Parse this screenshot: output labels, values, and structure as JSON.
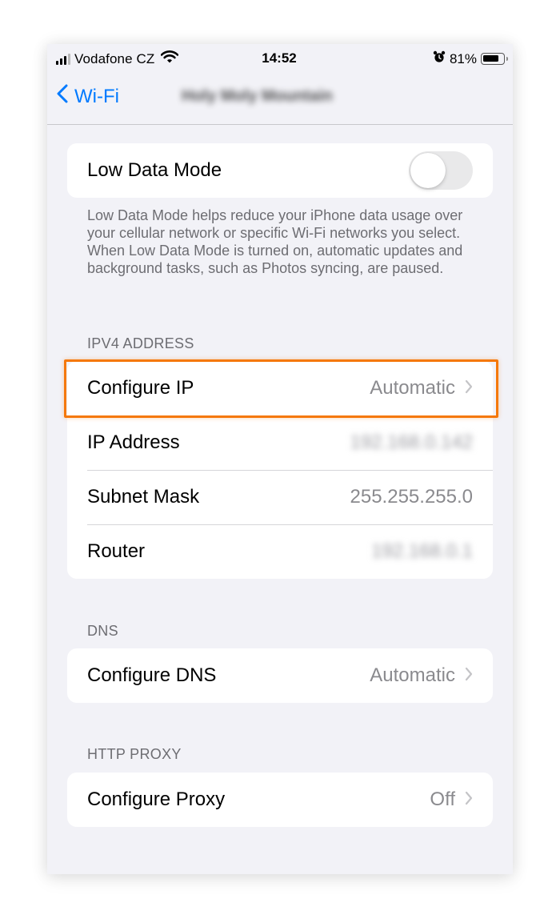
{
  "status_bar": {
    "carrier": "Vodafone CZ",
    "time": "14:52",
    "battery_percent": "81%",
    "battery_level": 0.81,
    "icons": [
      "signal-icon",
      "wifi-icon",
      "alarm-icon",
      "battery-icon"
    ]
  },
  "nav": {
    "back_label": "Wi-Fi",
    "title": "Holy Moly Mountain"
  },
  "low_data": {
    "label": "Low Data Mode",
    "toggle_on": false,
    "footer": "Low Data Mode helps reduce your iPhone data usage over your cellular network or specific Wi-Fi networks you select. When Low Data Mode is turned on, automatic updates and background tasks, such as Photos syncing, are paused."
  },
  "ipv4": {
    "header": "IPV4 ADDRESS",
    "configure_ip": {
      "label": "Configure IP",
      "value": "Automatic"
    },
    "ip_address": {
      "label": "IP Address",
      "value": "192.168.0.142"
    },
    "subnet_mask": {
      "label": "Subnet Mask",
      "value": "255.255.255.0"
    },
    "router": {
      "label": "Router",
      "value": "192.168.0.1"
    }
  },
  "dns": {
    "header": "DNS",
    "configure_dns": {
      "label": "Configure DNS",
      "value": "Automatic"
    }
  },
  "http_proxy": {
    "header": "HTTP PROXY",
    "configure_proxy": {
      "label": "Configure Proxy",
      "value": "Off"
    }
  },
  "colors": {
    "accent": "#007aff",
    "highlight": "#f5780a",
    "background": "#f2f2f7",
    "secondary_text": "#8a8a8e"
  }
}
